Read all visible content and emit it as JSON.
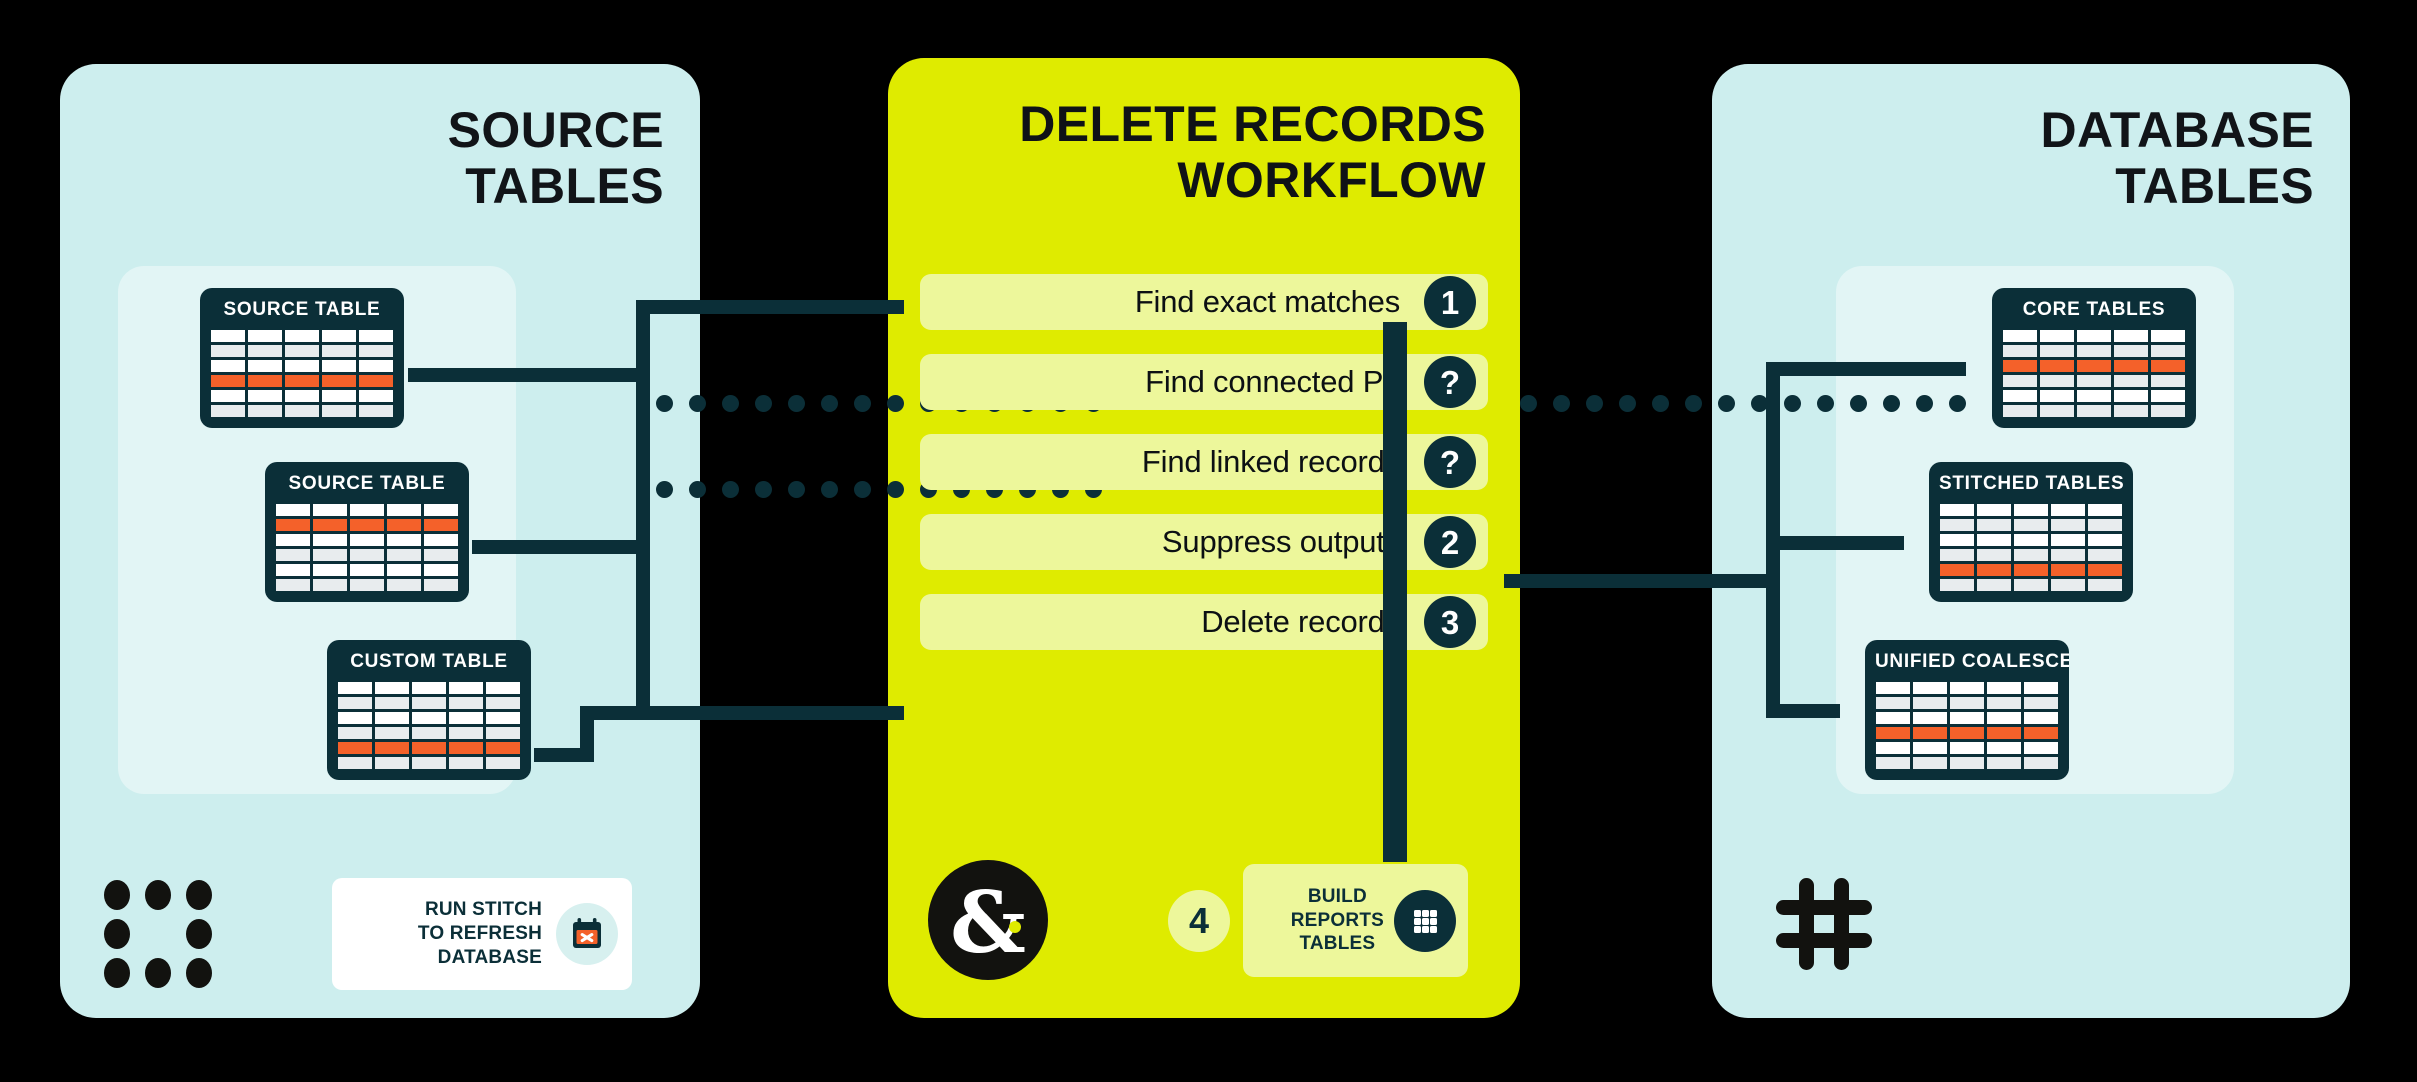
{
  "panels": {
    "left": {
      "title": "SOURCE\nTABLES",
      "bg": "#cdeeee"
    },
    "center": {
      "title": "DELETE RECORDS\nWORKFLOW",
      "bg": "#dfeb00"
    },
    "right": {
      "title": "DATABASE\nTABLES",
      "bg": "#cdeeee"
    }
  },
  "source_tables": [
    {
      "title": "SOURCE TABLE",
      "cols": 5,
      "rows": 6,
      "highlight_row": 4
    },
    {
      "title": "SOURCE TABLE",
      "cols": 5,
      "rows": 6,
      "highlight_row": 2
    },
    {
      "title": "CUSTOM TABLE",
      "cols": 5,
      "rows": 6,
      "highlight_row": 5
    }
  ],
  "database_tables": [
    {
      "title": "CORE TABLES",
      "cols": 5,
      "rows": 6,
      "highlight_row": 3
    },
    {
      "title": "STITCHED TABLES",
      "cols": 5,
      "rows": 6,
      "highlight_row": 5
    },
    {
      "title": "UNIFIED COALESCED",
      "cols": 5,
      "rows": 6,
      "highlight_row": 4
    }
  ],
  "workflow": {
    "steps": [
      {
        "label": "Find exact matches",
        "badge": "1"
      },
      {
        "label": "Find connected PII",
        "badge": "?"
      },
      {
        "label": "Find linked records",
        "badge": "?"
      },
      {
        "label": "Suppress outputs",
        "badge": "2"
      },
      {
        "label": "Delete records",
        "badge": "3"
      }
    ]
  },
  "footer": {
    "stitch_label": "RUN STITCH\nTO REFRESH\nDATABASE",
    "stitch_icon": "calendar-x-icon",
    "brand_icon": "ampersand-logo",
    "step_four": "4",
    "reports_label": "BUILD\nREPORTS\nTABLES",
    "reports_icon": "grid-3x3-icon",
    "hash_icon": "hash-icon",
    "dotgrid_icon": "dot-grid-icon"
  },
  "colors": {
    "dark": "#0b2f38",
    "lime": "#dfeb00",
    "lime_soft": "#edf79b",
    "mint": "#cdeeee",
    "orange": "#f4612a",
    "white": "#ffffff",
    "ink": "#12120f"
  }
}
